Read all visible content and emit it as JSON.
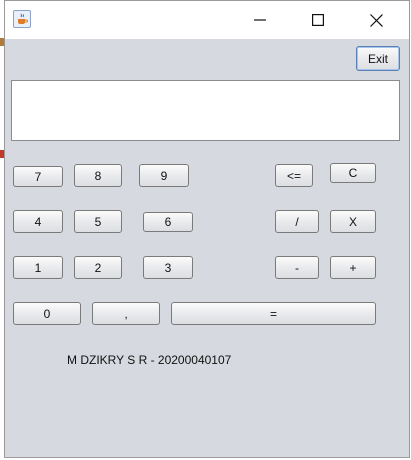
{
  "window": {
    "exit_label": "Exit",
    "display_value": ""
  },
  "keypad": {
    "k7": "7",
    "k8": "8",
    "k9": "9",
    "k4": "4",
    "k5": "5",
    "k6": "6",
    "k1": "1",
    "k2": "2",
    "k3": "3",
    "k0": "0",
    "comma": ",",
    "equals": "=",
    "backspace": "<=",
    "clear": "C",
    "divide": "/",
    "multiply": "X",
    "minus": "-",
    "plus": "+"
  },
  "footer": {
    "student_label": "M DZIKRY S R - 20200040107"
  },
  "icons": {
    "app": "java-cup-icon",
    "minimize": "minimize-icon",
    "maximize": "maximize-icon",
    "close": "close-icon"
  }
}
